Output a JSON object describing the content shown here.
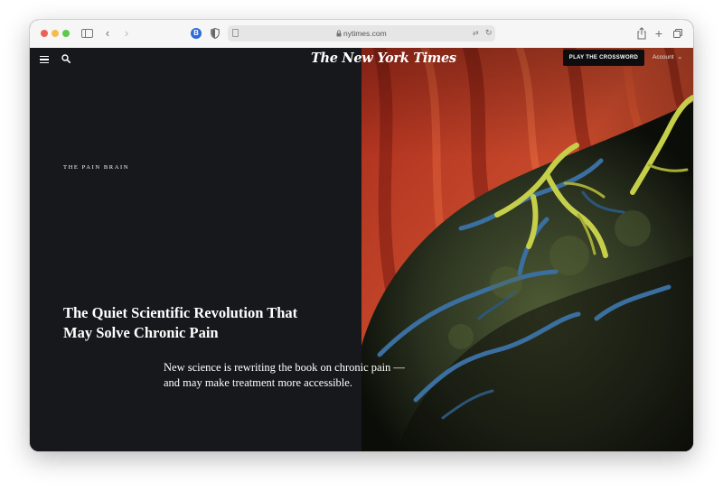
{
  "browser": {
    "url": "nytimes.com",
    "extension_badge": "B"
  },
  "nyt": {
    "masthead": "The New York Times",
    "crossword_button": "PLAY THE CROSSWORD",
    "account_label": "Account"
  },
  "article": {
    "kicker": "THE PAIN BRAIN",
    "headline_line1": "The Quiet Scientific Revolution That",
    "headline_line2": "May Solve Chronic Pain",
    "summary_line1": "New science is rewriting the book on chronic pain —",
    "summary_line2": "and may make treatment more accessible."
  },
  "colors": {
    "page_background": "#17181c",
    "hero_background": "#c2412a",
    "hero_nerve_yellow": "#c6cf4a",
    "hero_nerve_blue": "#3a6fa0",
    "hero_tissue_green": "#4a5a32"
  }
}
